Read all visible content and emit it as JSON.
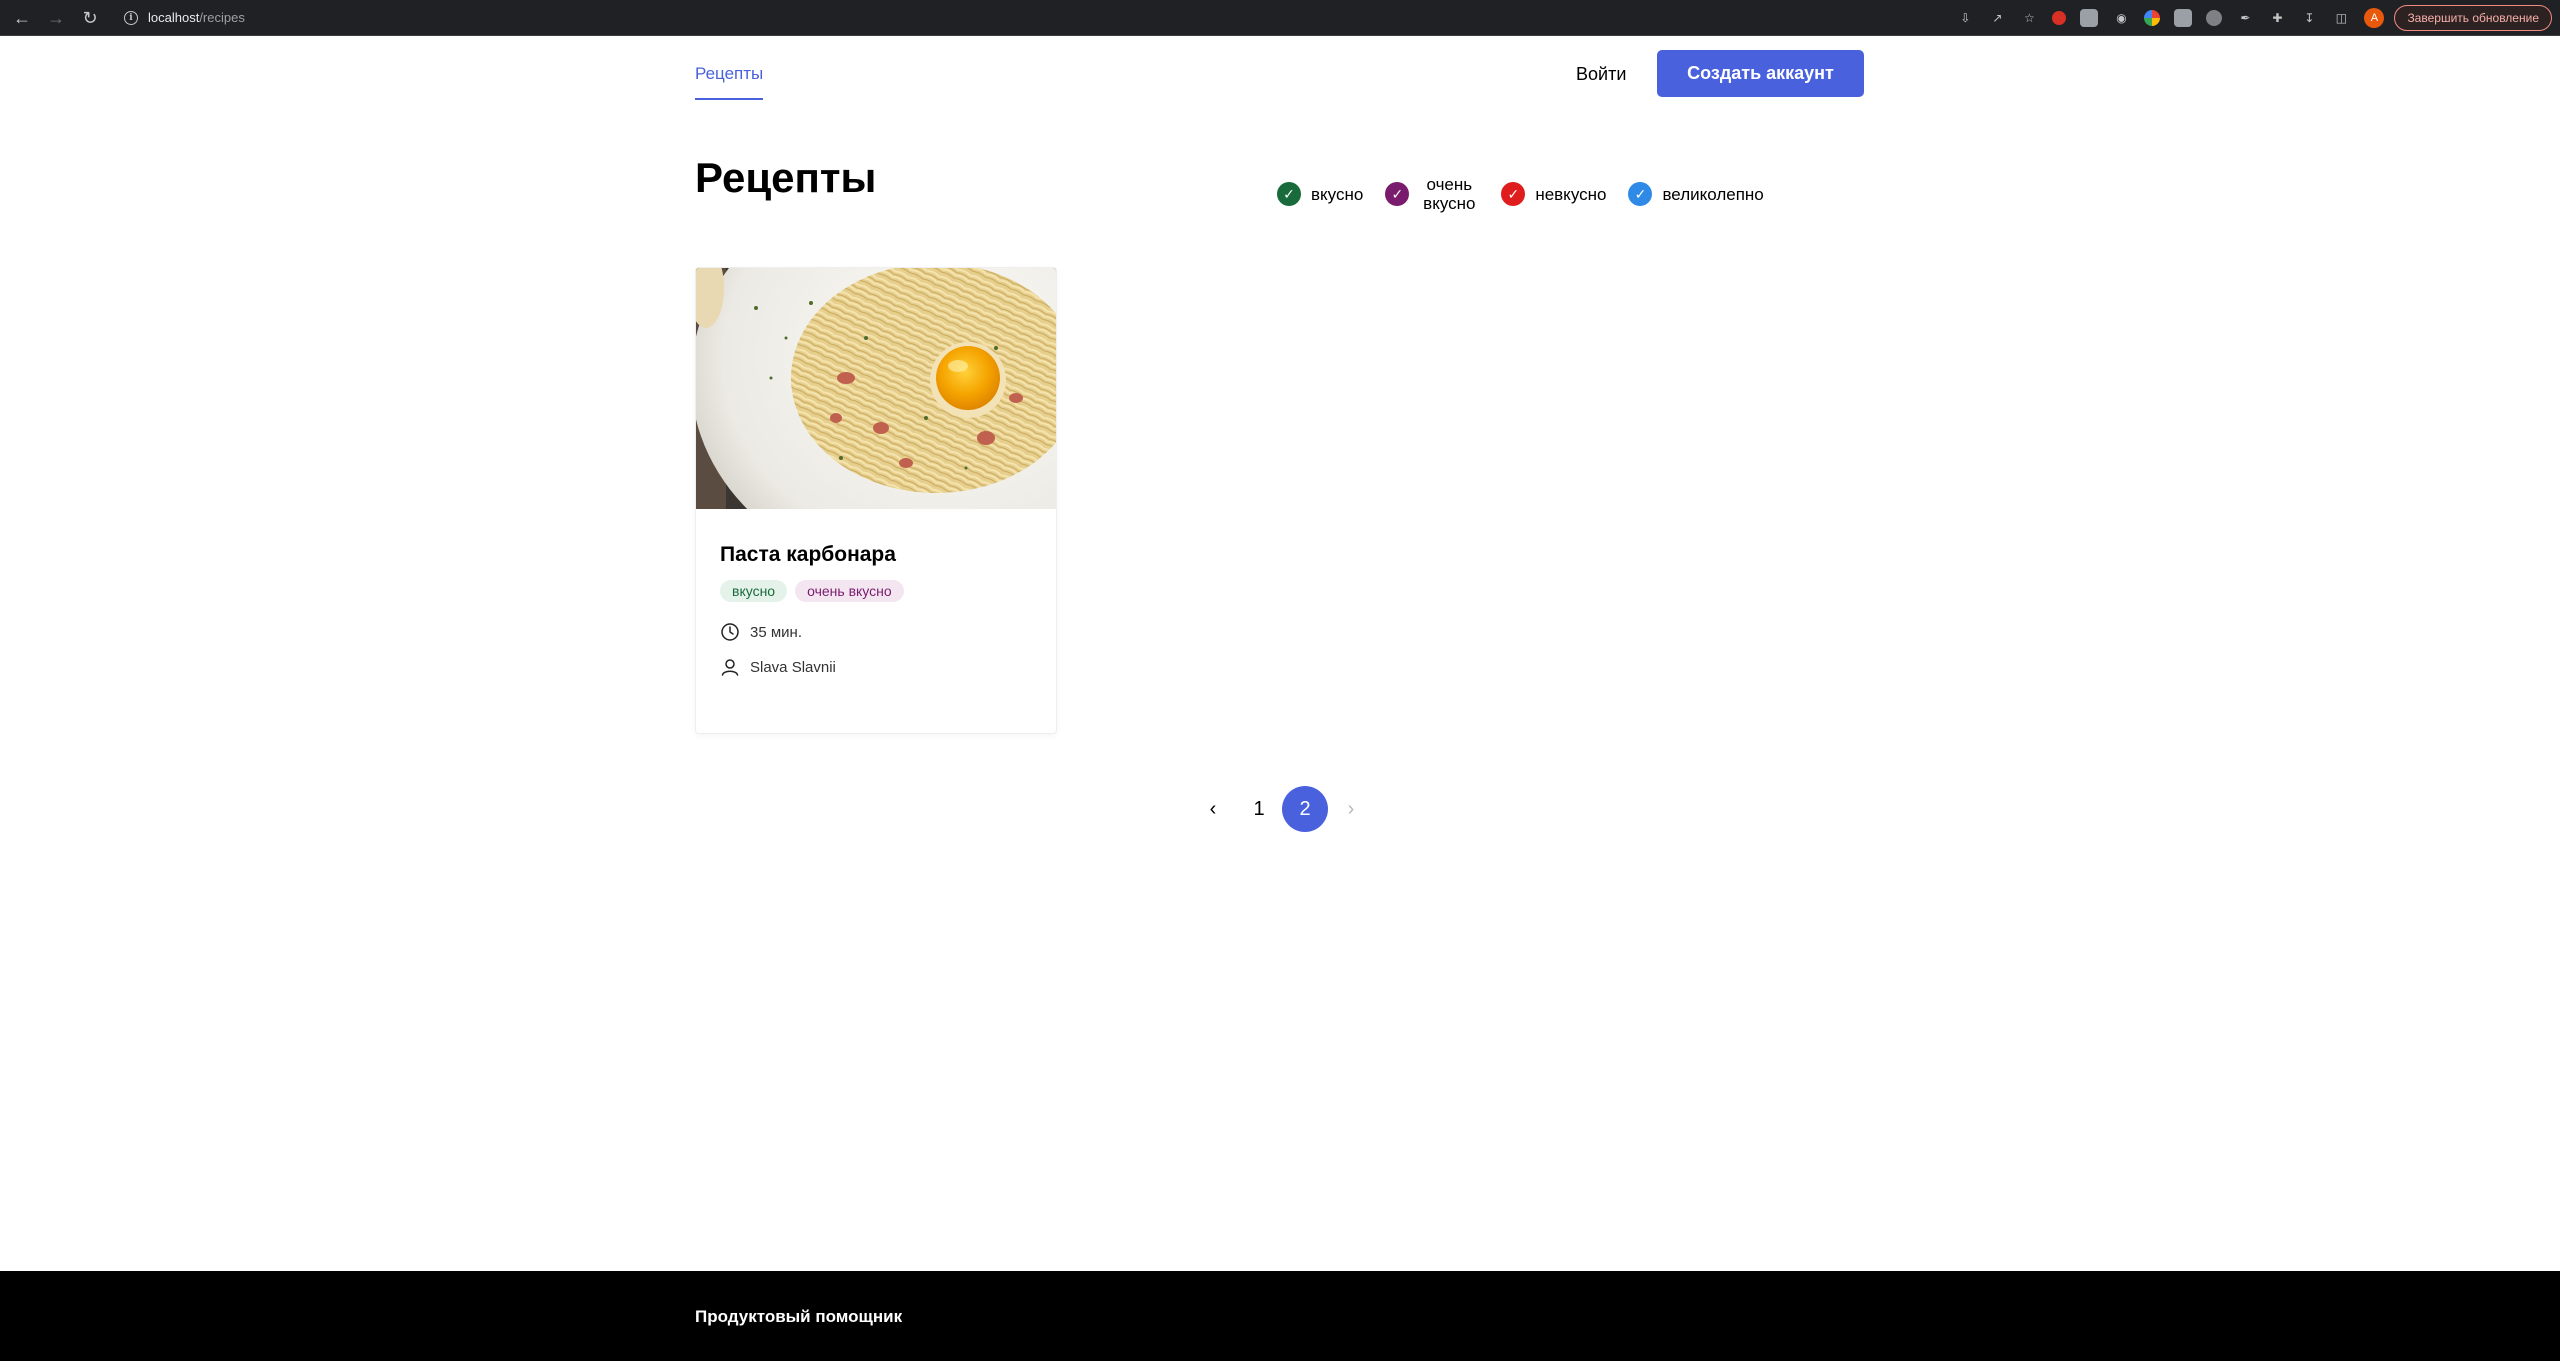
{
  "browser": {
    "url_host": "localhost",
    "url_path": "/recipes",
    "avatar_letter": "A",
    "update_button": "Завершить обновление"
  },
  "header": {
    "nav_recipes": "Рецепты",
    "login": "Войти",
    "signup": "Создать аккаунт"
  },
  "page": {
    "title": "Рецепты"
  },
  "filters": [
    {
      "label": "вкусно",
      "color": "#1a6b3c"
    },
    {
      "label": "очень вкусно",
      "color": "#7a1c6d"
    },
    {
      "label": "невкусно",
      "color": "#e01d1d"
    },
    {
      "label": "великолепно",
      "color": "#2e8ae6"
    }
  ],
  "recipes": [
    {
      "title": "Паста карбонара",
      "tags": [
        "вкусно",
        "очень вкусно"
      ],
      "time": "35 мин.",
      "author": "Slava Slavnii"
    }
  ],
  "pagination": {
    "pages": [
      "1",
      "2"
    ],
    "current": "2",
    "prev_arrow": "‹",
    "next_arrow": "›"
  },
  "footer": {
    "text": "Продуктовый помощник"
  },
  "colors": {
    "accent": "#4a61dd",
    "footer_bg": "#000000"
  }
}
